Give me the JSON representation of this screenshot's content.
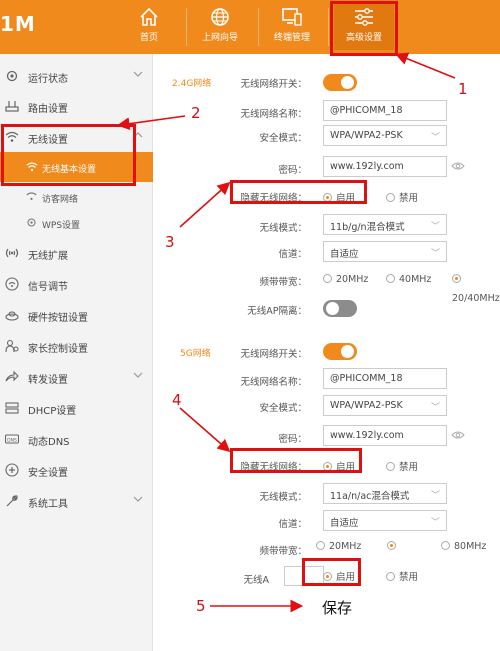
{
  "brand": {
    "logo_text": "1M"
  },
  "top_nav": [
    {
      "label": "首页",
      "icon": "home-icon"
    },
    {
      "label": "上网向导",
      "icon": "globe-icon"
    },
    {
      "label": "终端管理",
      "icon": "devices-icon"
    },
    {
      "label": "高级设置",
      "icon": "sliders-icon"
    }
  ],
  "sidebar": {
    "items": [
      {
        "label": "运行状态",
        "icon": "gear-icon"
      },
      {
        "label": "路由设置",
        "icon": "router-icon"
      },
      {
        "label": "无线设置",
        "icon": "wifi-icon"
      },
      {
        "label": "无线扩展",
        "icon": "signal-icon"
      },
      {
        "label": "信号调节",
        "icon": "wifi-circle-icon"
      },
      {
        "label": "硬件按钮设置",
        "icon": "button-icon"
      },
      {
        "label": "家长控制设置",
        "icon": "parent-icon"
      },
      {
        "label": "转发设置",
        "icon": "forward-icon"
      },
      {
        "label": "DHCP设置",
        "icon": "dhcp-icon"
      },
      {
        "label": "动态DNS",
        "icon": "dns-icon"
      },
      {
        "label": "安全设置",
        "icon": "shield-icon"
      },
      {
        "label": "系统工具",
        "icon": "wrench-icon"
      }
    ],
    "sub_items": [
      {
        "label": "无线基本设置",
        "icon": "wifi-icon"
      },
      {
        "label": "访客网络",
        "icon": "guest-icon"
      },
      {
        "label": "WPS设置",
        "icon": "gear-icon"
      }
    ]
  },
  "band_24": {
    "section_label": "2.4G网络",
    "switch_label": "无线网络开关：",
    "name_label": "无线网络名称：",
    "name_value": "@PHICOMM_18",
    "security_label": "安全模式：",
    "security_value": "WPA/WPA2-PSK",
    "password_label": "密码：",
    "password_value": "www.192ly.com",
    "hide_label": "隐藏无线网络：",
    "enable_label": "启用",
    "disable_label": "禁用",
    "mode_label": "无线模式：",
    "mode_value": "11b/g/n混合模式",
    "channel_label": "信道：",
    "channel_value": "自适应",
    "bandwidth_label": "频带带宽：",
    "bw_opt1": "20MHz",
    "bw_opt2": "40MHz",
    "bw_opt3": "20/40MHz",
    "ap_isolation_label": "无线AP隔离："
  },
  "band_5": {
    "section_label": "5G网络",
    "switch_label": "无线网络开关：",
    "name_label": "无线网络名称：",
    "name_value": "@PHICOMM_18",
    "security_label": "安全模式：",
    "security_value": "WPA/WPA2-PSK",
    "password_label": "密码：",
    "password_value": "www.192ly.com",
    "hide_label": "隐藏无线网络：",
    "enable_label": "启用",
    "disable_label": "禁用",
    "mode_label": "无线模式：",
    "mode_value": "11a/n/ac混合模式",
    "channel_label": "信道：",
    "channel_value": "自适应",
    "bandwidth_label": "频带带宽：",
    "bw_opt1": "20MHz",
    "bw_opt3": "80MHz",
    "ap_label_partial": "无线A",
    "ap_enable_label": "启用",
    "ap_disable_label": "禁用"
  },
  "annotations": {
    "n1": "1",
    "n2": "2",
    "n3": "3",
    "n4": "4",
    "n5": "5",
    "save_text": "保存",
    "color": "#e01010"
  },
  "colors": {
    "accent": "#f08a1c",
    "annotation": "#e01010"
  }
}
